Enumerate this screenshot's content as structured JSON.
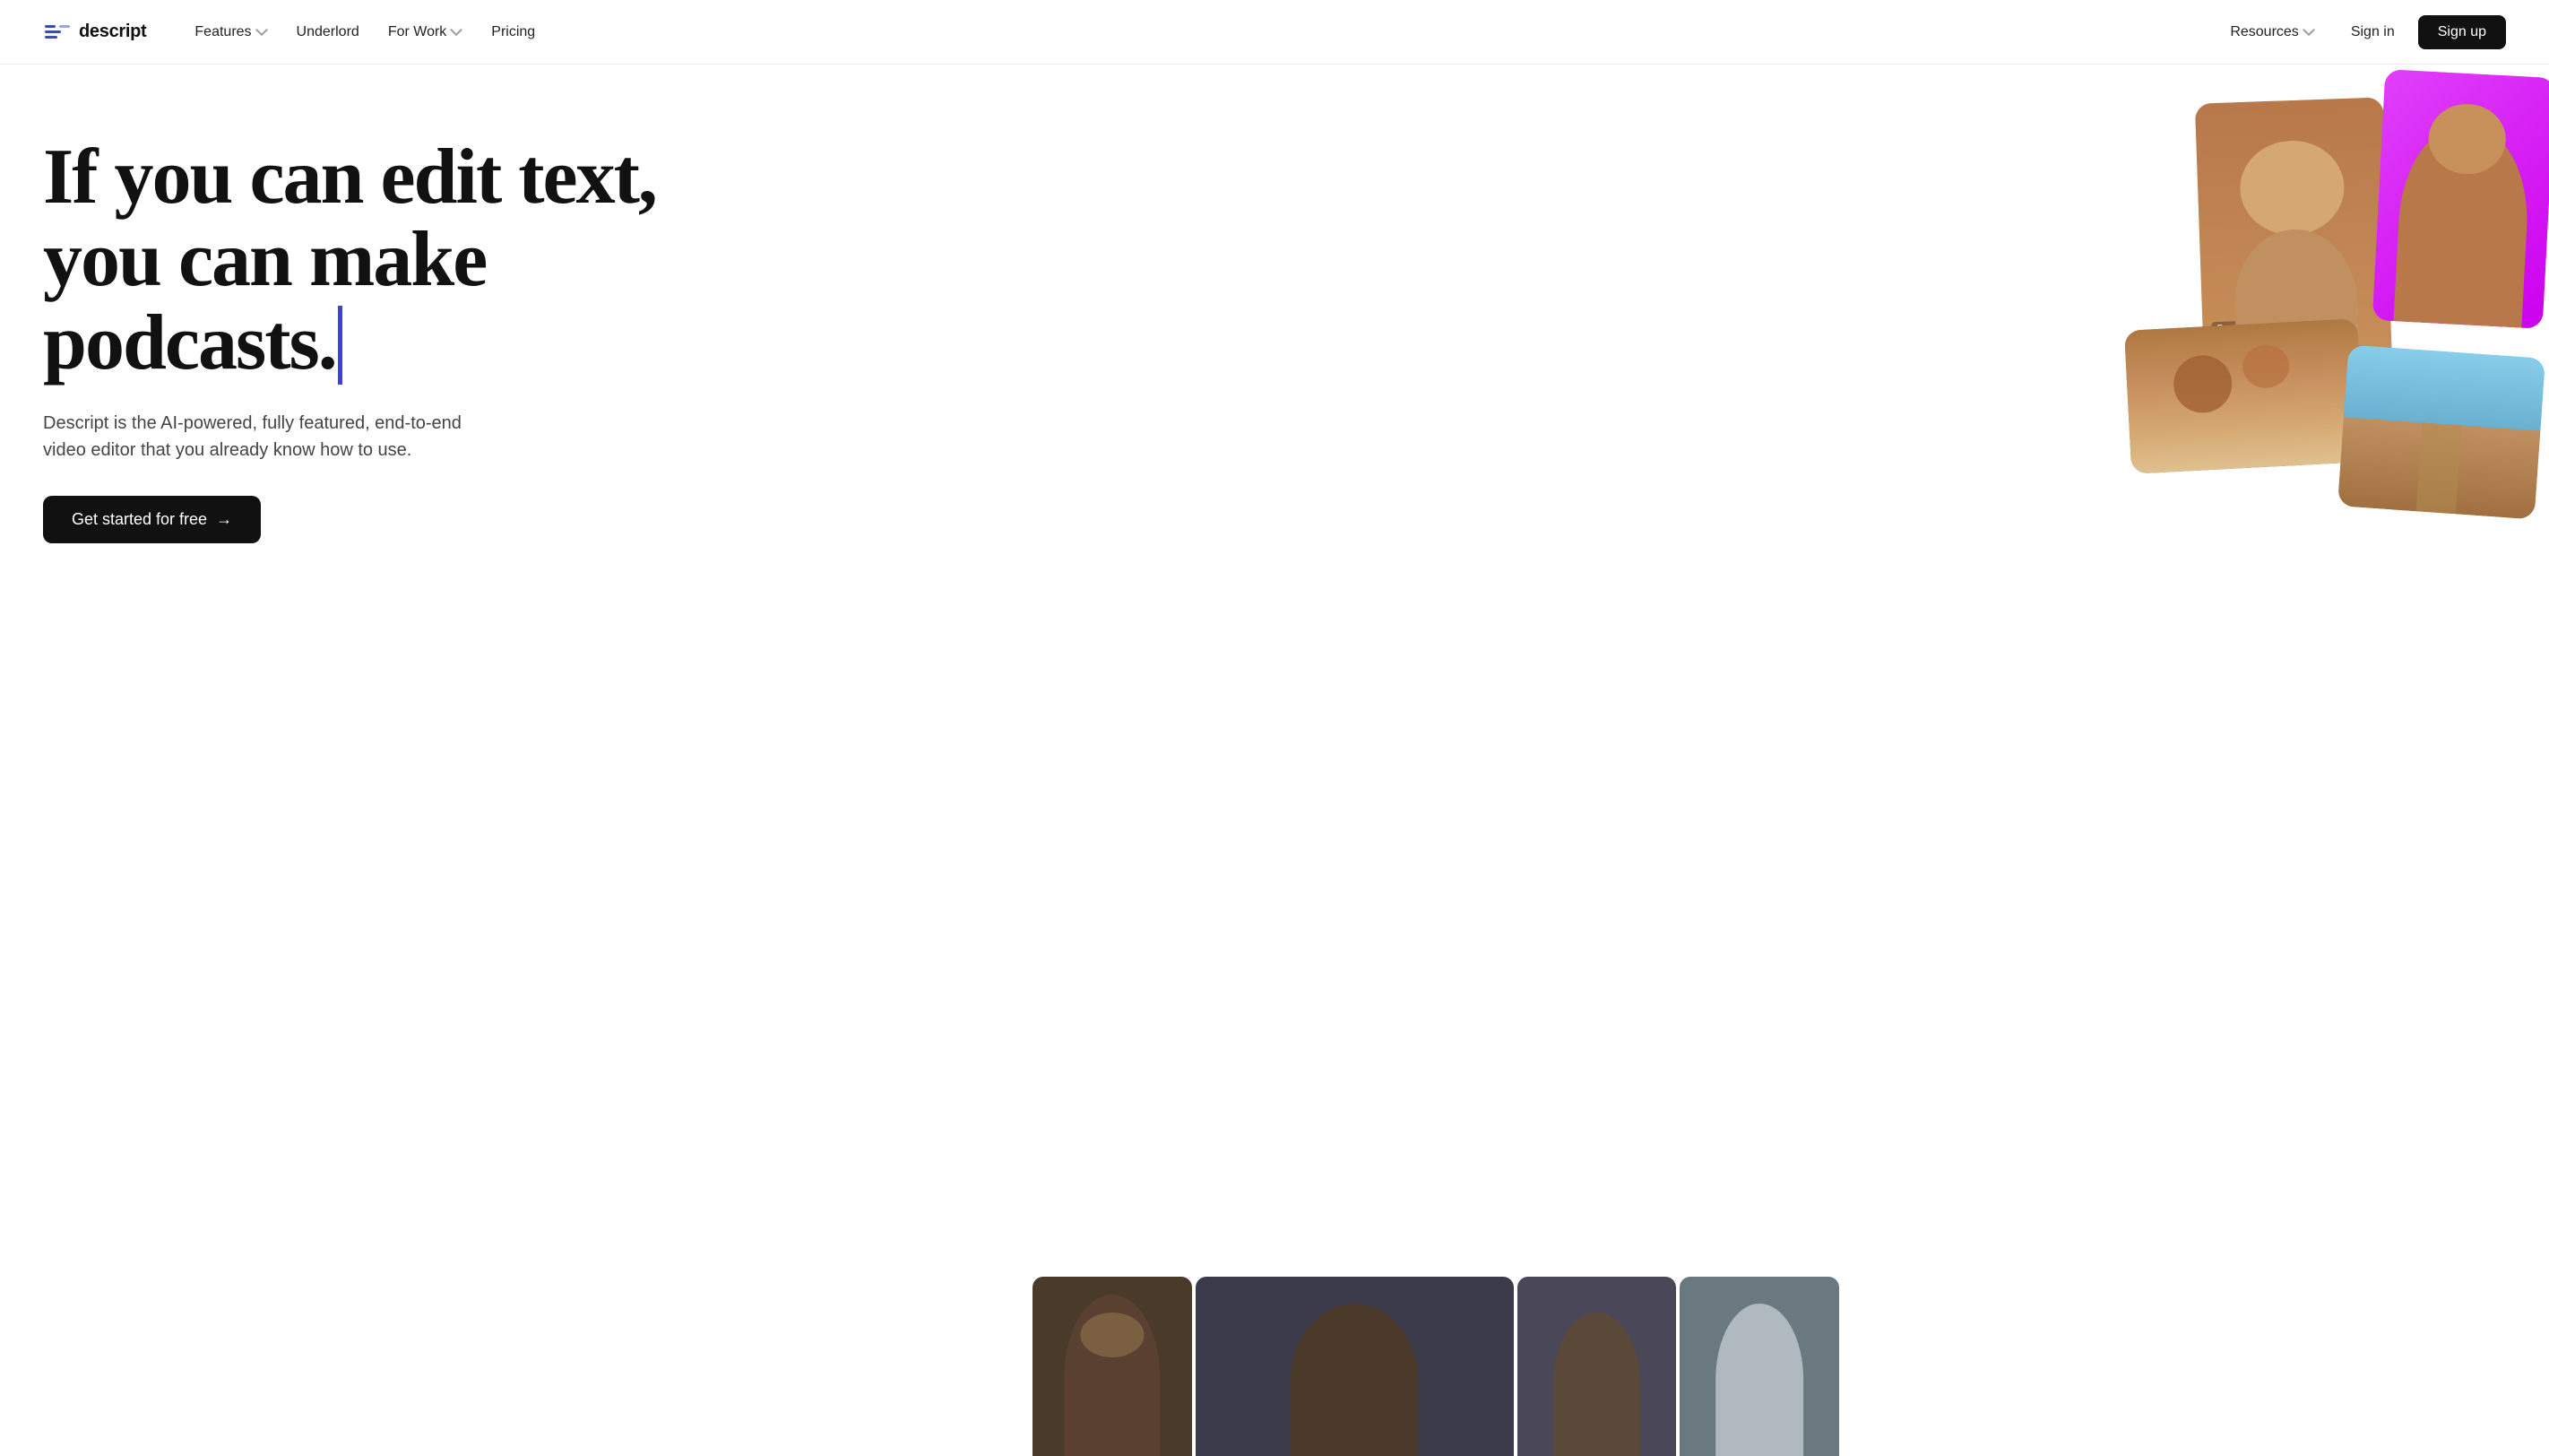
{
  "nav": {
    "logo_text": "descript",
    "links_left": [
      {
        "label": "Features",
        "has_dropdown": true
      },
      {
        "label": "Underlord",
        "has_dropdown": false
      },
      {
        "label": "For Work",
        "has_dropdown": true
      },
      {
        "label": "Pricing",
        "has_dropdown": false
      }
    ],
    "links_right": [
      {
        "label": "Resources",
        "has_dropdown": true
      },
      {
        "label": "Sign in",
        "has_dropdown": false
      }
    ],
    "signup_label": "Sign up"
  },
  "hero": {
    "headline_line1": "If you can edit text,",
    "headline_line2": "you can make podcasts.",
    "subtext": "Descript is the AI-powered, fully featured, end-to-end video editor that you already know how to use.",
    "cta_label": "Get started for free",
    "cta_arrow": "→"
  },
  "colors": {
    "accent_blue": "#4040e0",
    "signup_bg": "#111111",
    "logo_blue": "#3d4eac"
  }
}
